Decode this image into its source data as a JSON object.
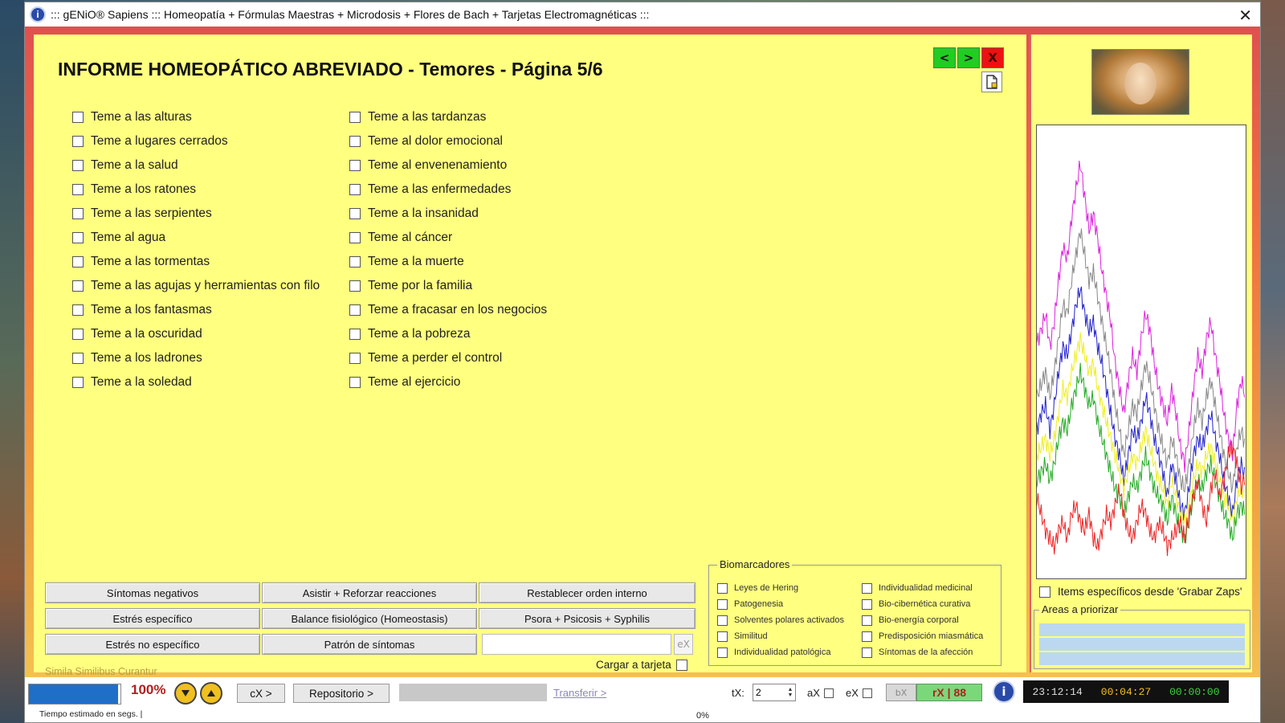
{
  "window": {
    "title": "::: gENiO® Sapiens ::: Homeopatía + Fórmulas Maestras + Microdosis + Flores de Bach + Tarjetas Electromagnéticas :::",
    "app_icon_glyph": "i",
    "close_glyph": "✕"
  },
  "report": {
    "title": "INFORME HOMEOPÁTICO ABREVIADO - Temores - Página 5/6",
    "nav_prev": "<",
    "nav_next": ">",
    "nav_close": "X",
    "col1": [
      "Teme a las alturas",
      "Teme a lugares cerrados",
      "Teme a la salud",
      "Teme a los ratones",
      "Teme a las serpientes",
      "Teme al agua",
      "Teme a las tormentas",
      "Teme a las agujas y herramientas con filo",
      "Teme a los fantasmas",
      "Teme a la oscuridad",
      "Teme a los ladrones",
      "Teme a la soledad"
    ],
    "col2": [
      "Teme a las tardanzas",
      "Teme al dolor emocional",
      "Teme al envenenamiento",
      "Teme a las enfermedades",
      "Teme a la insanidad",
      "Teme al cáncer",
      "Teme a la muerte",
      "Teme por la familia",
      "Teme a fracasar en los negocios",
      "Teme a la pobreza",
      "Teme a perder el control",
      "Teme al ejercicio"
    ]
  },
  "buttons": {
    "sintomas_negativos": "Síntomas negativos",
    "asistir": "Asistir + Reforzar reacciones",
    "restablecer": "Restablecer orden interno",
    "estres_especifico": "Estrés específico",
    "balance": "Balance fisiológico (Homeostasis)",
    "psora": "Psora + Psicosis + Syphilis",
    "estres_no_especifico": "Estrés no específico",
    "patron": "Patrón de síntomas",
    "ex": "eX"
  },
  "cargar_label": "Cargar a tarjeta",
  "simila": "Simila Similibus Curantur",
  "biomarcadores": {
    "legend": "Biomarcadores",
    "col1": [
      "Leyes de Hering",
      "Patogenesia",
      "Solventes polares activados",
      "Similitud",
      "Individualidad patológica"
    ],
    "col2": [
      "Individualidad medicinal",
      "Bio-cibernética curativa",
      "Bio-energía corporal",
      "Predisposición miasmática",
      "Síntomas de la afección"
    ]
  },
  "side": {
    "items_label": "Items específicos desde 'Grabar Zaps'",
    "areas_legend": "Areas a priorizar"
  },
  "chart_data": {
    "type": "line",
    "series": [
      {
        "color": "#dd22dd",
        "values": [
          55,
          58,
          62,
          54,
          60,
          70,
          78,
          75,
          85,
          92,
          98,
          90,
          82,
          86,
          80,
          72,
          66,
          60,
          50,
          44,
          38,
          46,
          52,
          48,
          56,
          62,
          58,
          50,
          44,
          40,
          36,
          44,
          38,
          30,
          26,
          34,
          44,
          52,
          48,
          56,
          60,
          52,
          46,
          38,
          32,
          28,
          40,
          46,
          42
        ]
      },
      {
        "color": "#888888",
        "values": [
          42,
          45,
          48,
          42,
          48,
          56,
          64,
          62,
          70,
          76,
          82,
          76,
          70,
          72,
          66,
          60,
          54,
          48,
          40,
          34,
          28,
          34,
          40,
          38,
          44,
          50,
          46,
          40,
          34,
          30,
          26,
          32,
          28,
          22,
          20,
          26,
          34,
          40,
          36,
          42,
          46,
          40,
          34,
          28,
          24,
          20,
          30,
          34,
          30
        ]
      },
      {
        "color": "#2222cc",
        "values": [
          34,
          38,
          40,
          34,
          40,
          48,
          54,
          52,
          58,
          64,
          68,
          62,
          58,
          60,
          54,
          50,
          44,
          38,
          32,
          28,
          22,
          28,
          34,
          32,
          36,
          42,
          38,
          32,
          28,
          24,
          18,
          26,
          22,
          16,
          14,
          20,
          28,
          32,
          30,
          34,
          38,
          32,
          28,
          22,
          18,
          14,
          22,
          26,
          22
        ]
      },
      {
        "color": "#eeee22",
        "values": [
          28,
          30,
          32,
          28,
          32,
          38,
          44,
          42,
          48,
          52,
          56,
          52,
          48,
          50,
          44,
          40,
          36,
          32,
          28,
          24,
          20,
          24,
          28,
          26,
          30,
          34,
          30,
          26,
          22,
          20,
          16,
          22,
          18,
          14,
          12,
          16,
          22,
          26,
          24,
          28,
          30,
          26,
          22,
          18,
          16,
          12,
          18,
          20,
          18
        ]
      },
      {
        "color": "#22aa22",
        "values": [
          22,
          24,
          26,
          22,
          26,
          32,
          36,
          34,
          40,
          44,
          48,
          44,
          40,
          42,
          36,
          32,
          28,
          24,
          20,
          18,
          14,
          18,
          22,
          20,
          24,
          28,
          24,
          20,
          18,
          16,
          12,
          18,
          14,
          10,
          8,
          12,
          18,
          22,
          20,
          24,
          26,
          22,
          18,
          14,
          12,
          8,
          14,
          16,
          14
        ]
      },
      {
        "color": "#ee2222",
        "values": [
          18,
          14,
          10,
          8,
          6,
          10,
          12,
          8,
          14,
          16,
          12,
          10,
          14,
          8,
          6,
          10,
          14,
          12,
          16,
          20,
          14,
          10,
          8,
          12,
          16,
          14,
          10,
          8,
          12,
          10,
          6,
          8,
          10,
          12,
          8,
          14,
          18,
          22,
          16,
          12,
          20,
          24,
          18,
          22,
          28,
          30,
          26,
          20,
          24
        ]
      }
    ]
  },
  "status": {
    "progress_pct": 0.97,
    "pct_big": "100%",
    "cx": "cX >",
    "repositorio": "Repositorio >",
    "transferir": "Transferir >",
    "tx_label": "tX:",
    "tx_value": "2",
    "ax_label": "aX",
    "ex_label": "eX",
    "bx": "bX",
    "rx": "rX | 88",
    "time1": "23:12:14",
    "time2": "00:04:27",
    "time3": "00:00:00",
    "tiempo": "Tiempo estimado en segs. |",
    "pct_small": "0%"
  }
}
